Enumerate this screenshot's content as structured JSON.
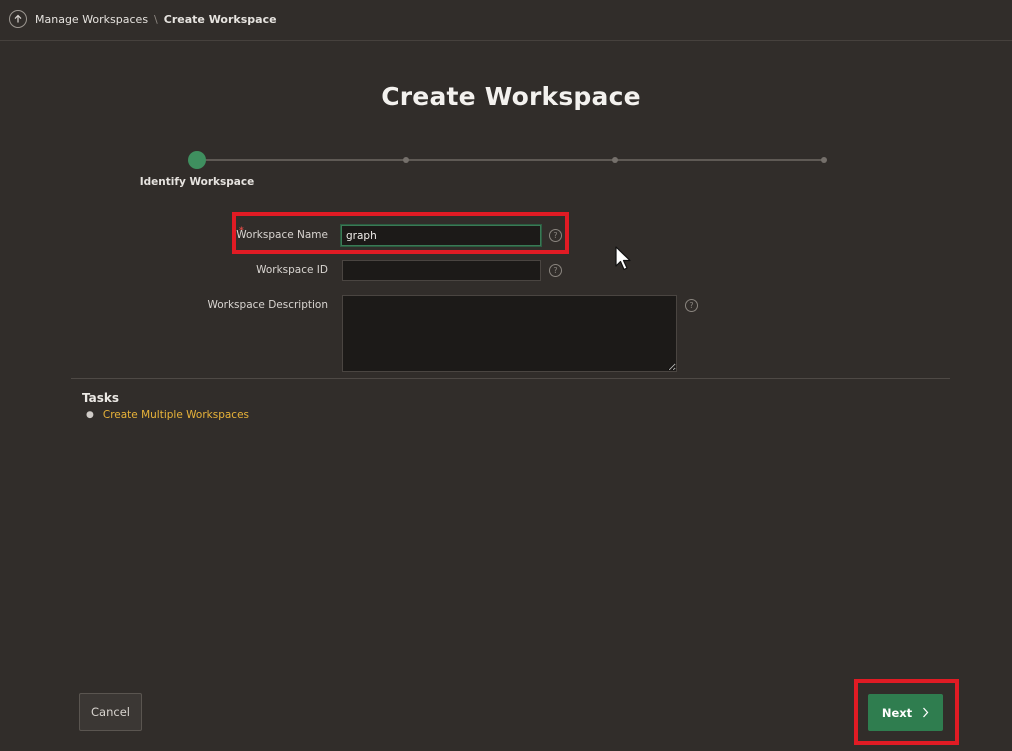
{
  "breadcrumb": {
    "up_icon": "arrow-up-circle-icon",
    "parent": "Manage Workspaces",
    "separator": "\\",
    "current": "Create Workspace"
  },
  "page_title": "Create Workspace",
  "wizard": {
    "active_step": 1,
    "total_steps": 4,
    "active_label": "Identify Workspace"
  },
  "form": {
    "workspace_name": {
      "label": "Workspace Name",
      "value": "graph",
      "required": true
    },
    "workspace_id": {
      "label": "Workspace ID",
      "value": ""
    },
    "workspace_description": {
      "label": "Workspace Description",
      "value": ""
    },
    "help_icon": "question-circle-icon"
  },
  "tasks": {
    "title": "Tasks",
    "items": [
      "Create Multiple Workspaces"
    ]
  },
  "buttons": {
    "cancel": "Cancel",
    "next": "Next",
    "next_icon": "chevron-right-icon"
  },
  "colors": {
    "background": "#312d2a",
    "accent_green": "#2f7d4f",
    "highlight_red": "#e01b24",
    "link": "#e8b339"
  }
}
